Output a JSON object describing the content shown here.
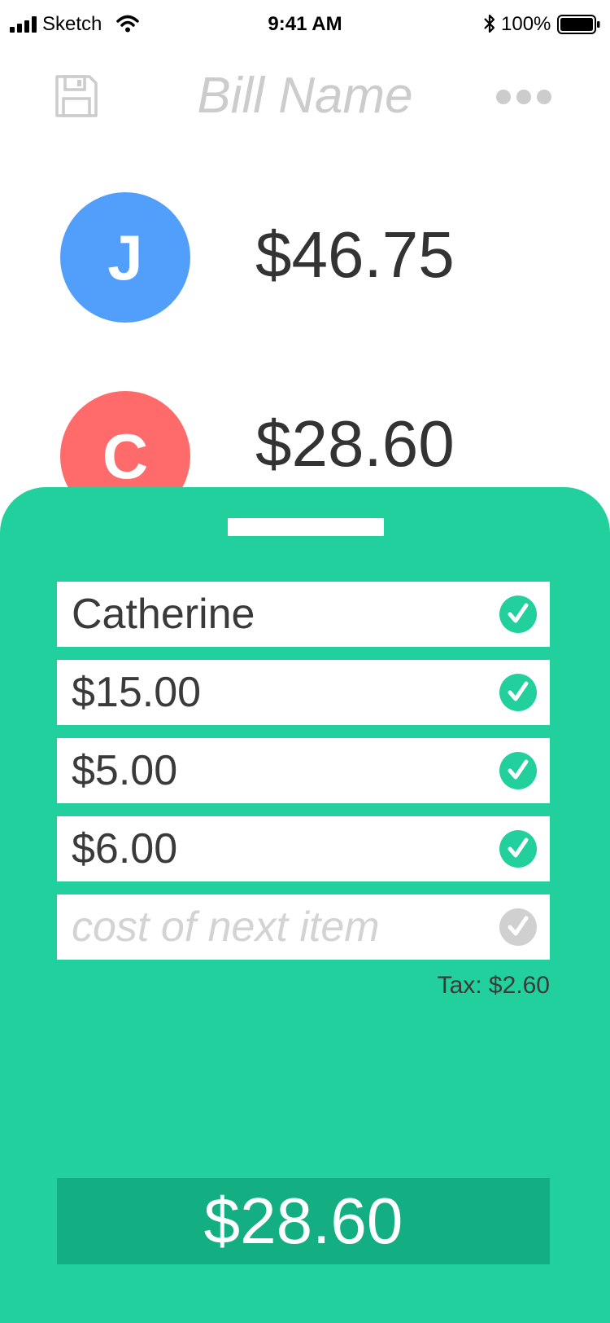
{
  "status_bar": {
    "carrier": "Sketch",
    "time": "9:41 AM",
    "battery": "100%"
  },
  "header": {
    "title": "Bill Name",
    "save_icon": "floppy-disk-icon",
    "more_icon": "ellipsis-icon"
  },
  "people": [
    {
      "initial": "J",
      "total": "$46.75",
      "color": "#529ffb"
    },
    {
      "initial": "C",
      "total": "$28.60",
      "color": "#ff6b6b"
    }
  ],
  "sheet": {
    "name_value": "Catherine",
    "items": [
      "$15.00",
      "$5.00",
      "$6.00"
    ],
    "new_item_placeholder": "cost of next item",
    "tax": "Tax: $2.60",
    "total": "$28.60"
  },
  "colors": {
    "accent": "#21d09d",
    "accent_dark": "#13ae82",
    "inactive": "#cccccc"
  }
}
